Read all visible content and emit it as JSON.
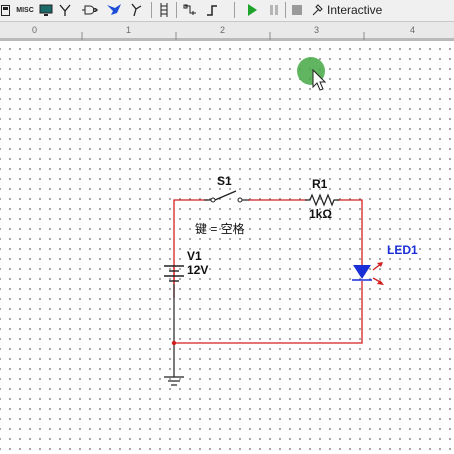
{
  "toolbar": {
    "misc_label": "MISC",
    "interactive_label": "Interactive",
    "icons": [
      "save-icon",
      "misc-icon",
      "monitor-icon",
      "antenna-icon",
      "gate-icon",
      "tool-icon",
      "probe-icon",
      "ladder-icon",
      "ground-icon",
      "step-icon",
      "play-icon",
      "pause-icon",
      "stop-icon",
      "interactive-icon"
    ]
  },
  "ruler": {
    "ticks": [
      "0",
      "1",
      "2",
      "3",
      "4"
    ]
  },
  "circuit": {
    "switch": {
      "ref": "S1",
      "key_label": "键 = 空格"
    },
    "resistor": {
      "ref": "R1",
      "value": "1kΩ"
    },
    "source": {
      "ref": "V1",
      "value": "12V"
    },
    "led": {
      "ref": "LED1"
    }
  },
  "colors": {
    "wire": "#d42020",
    "led": "#1a2ed8",
    "cursor_halo": "#45a845"
  }
}
